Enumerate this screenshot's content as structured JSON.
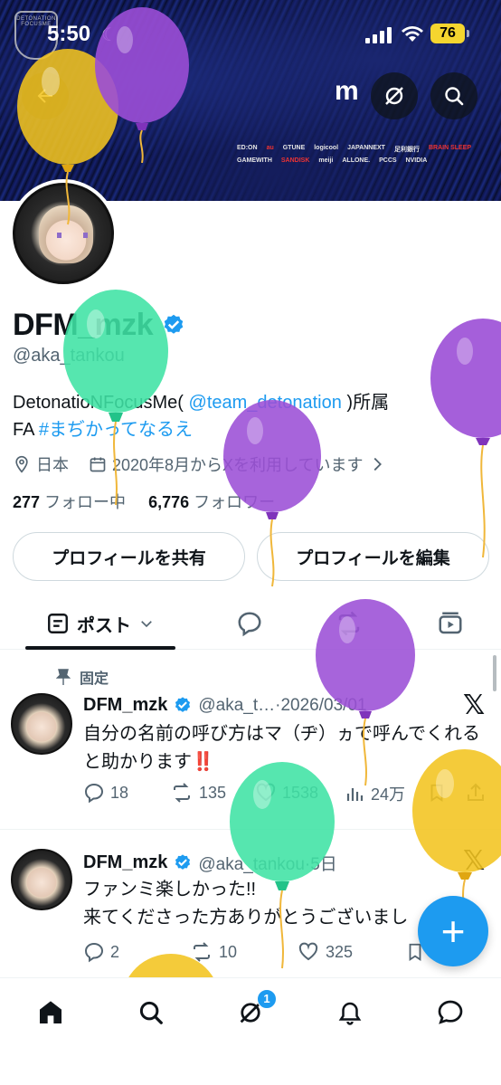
{
  "status_bar": {
    "time": "5:50",
    "battery": "76"
  },
  "banner": {
    "logo_text": "DETONATION FOCUSME",
    "brand_mark": "m",
    "sponsors": [
      "ED:ON",
      "au",
      "GTUNE",
      "logicool",
      "JAPANNEXT",
      "足利銀行",
      "BRAIN SLEEP",
      "GAMEWITH",
      "SANDISK",
      "meiji",
      "ALLONE.",
      "PCCS",
      "NVIDIA"
    ]
  },
  "profile": {
    "display_name": "DFM_mzk",
    "handle": "@aka_tankou",
    "bio_prefix": "DetonatioNFocusMe(",
    "bio_link": "@team_detonation",
    "bio_suffix": ")所属",
    "bio_line2_prefix": "FA",
    "bio_hashtag": "#まぢかってなるえ",
    "location": "日本",
    "joined": "2020年8月からXを利用しています",
    "following_count": "277",
    "following_label": "フォロー中",
    "followers_count": "6,776",
    "followers_label": "フォロワー",
    "share_button": "プロフィールを共有",
    "edit_button": "プロフィールを編集"
  },
  "tabs": {
    "posts_label": "ポスト"
  },
  "posts": [
    {
      "pinned_label": "固定",
      "name": "DFM_mzk",
      "meta": "@aka_t…·2026/03/01",
      "text": "自分の名前の呼び方はマ（ヂ）ヵで呼んでくれると助かります",
      "emphasis": "‼️",
      "replies": "18",
      "reposts": "135",
      "likes": "1538",
      "views": "24万"
    },
    {
      "name": "DFM_mzk",
      "meta": "@aka_tankou·5日",
      "text_line1": "ファンミ楽しかった!!",
      "text_line2": "来てくださった方ありがとうございまし",
      "replies": "2",
      "reposts": "10",
      "likes": "325"
    }
  ],
  "nav": {
    "grok_badge": "1"
  },
  "colors": {
    "accent": "#1d9bf0",
    "balloon_purple": "#9b4ed6",
    "balloon_yellow": "#f2c41f",
    "balloon_green": "#3fe3a4"
  }
}
